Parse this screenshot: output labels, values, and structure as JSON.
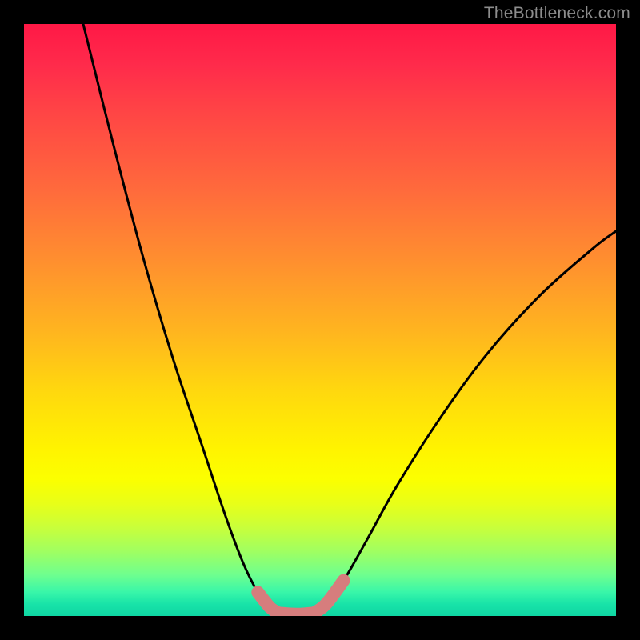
{
  "watermark": "TheBottleneck.com",
  "chart_data": {
    "type": "line",
    "title": "",
    "xlabel": "",
    "ylabel": "",
    "xlim": [
      0,
      100
    ],
    "ylim": [
      0,
      100
    ],
    "grid": false,
    "legend": false,
    "series": [
      {
        "name": "left-falling-curve",
        "color": "#000000",
        "x": [
          10,
          15,
          20,
          25,
          30,
          34,
          37,
          39.5,
          41.5,
          43
        ],
        "y": [
          100,
          80,
          61,
          44,
          29,
          17,
          9,
          4,
          1.5,
          0.5
        ]
      },
      {
        "name": "right-rising-curve",
        "color": "#000000",
        "x": [
          49,
          51,
          54,
          58,
          63,
          70,
          78,
          87,
          96,
          100
        ],
        "y": [
          0.5,
          2,
          6,
          13,
          22,
          33,
          44,
          54,
          62,
          65
        ]
      },
      {
        "name": "bottom-flat",
        "color": "#000000",
        "x": [
          43,
          49
        ],
        "y": [
          0.5,
          0.5
        ]
      },
      {
        "name": "highlight-left-tip",
        "color": "#d67d7d",
        "x": [
          39.5,
          41.5,
          43
        ],
        "y": [
          4,
          1.5,
          0.5
        ]
      },
      {
        "name": "highlight-bottom",
        "color": "#d67d7d",
        "x": [
          43,
          46,
          49
        ],
        "y": [
          0.5,
          0.3,
          0.5
        ]
      },
      {
        "name": "highlight-right-tip",
        "color": "#d67d7d",
        "x": [
          49,
          51,
          54
        ],
        "y": [
          0.5,
          2,
          6
        ]
      }
    ],
    "background_gradient": {
      "direction": "vertical",
      "stops": [
        {
          "pos": 0.0,
          "color": "#ff1846"
        },
        {
          "pos": 0.28,
          "color": "#ff6a3c"
        },
        {
          "pos": 0.62,
          "color": "#ffd80e"
        },
        {
          "pos": 0.8,
          "color": "#f0ff10"
        },
        {
          "pos": 0.93,
          "color": "#6fff8e"
        },
        {
          "pos": 1.0,
          "color": "#0fd6a3"
        }
      ]
    }
  }
}
